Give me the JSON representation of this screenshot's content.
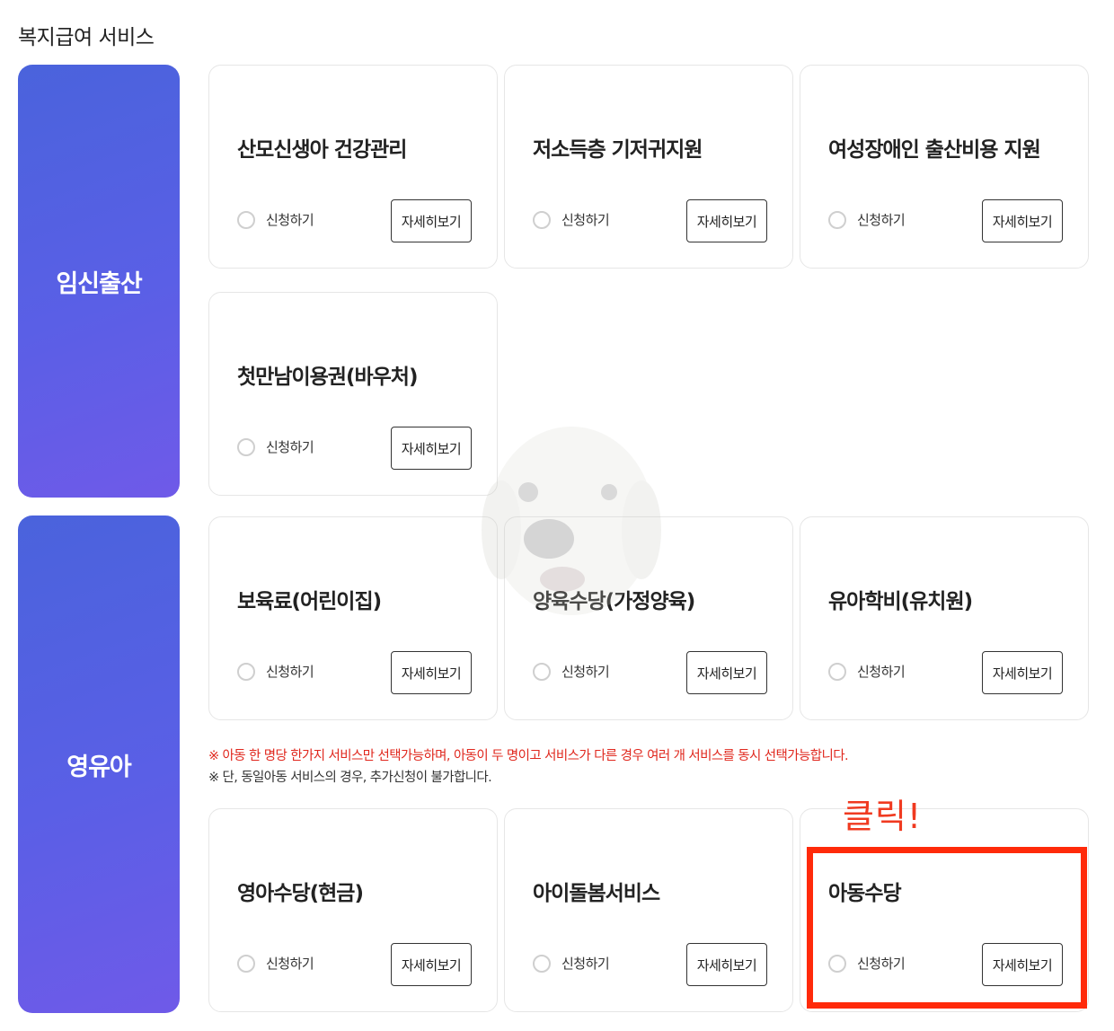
{
  "page_title": "복지급여 서비스",
  "common": {
    "apply_label": "신청하기",
    "detail_label": "자세히보기"
  },
  "categories": [
    {
      "label": "임신출산"
    },
    {
      "label": "영유아"
    }
  ],
  "pregnancy_services": [
    {
      "title": "산모신생아 건강관리"
    },
    {
      "title": "저소득층 기저귀지원"
    },
    {
      "title": "여성장애인 출산비용 지원"
    },
    {
      "title": "첫만남이용권(바우처)"
    }
  ],
  "infant_services_top": [
    {
      "title": "보육료(어린이집)"
    },
    {
      "title": "양육수당(가정양육)"
    },
    {
      "title": "유아학비(유치원)"
    }
  ],
  "notices": [
    "※ 아동 한 명당 한가지 서비스만 선택가능하며, 아동이 두 명이고 서비스가 다른 경우 여러 개 서비스를 동시 선택가능합니다.",
    "※ 단, 동일아동 서비스의 경우, 추가신청이 불가합니다."
  ],
  "infant_services_bottom": [
    {
      "title": "영아수당(현금)"
    },
    {
      "title": "아이돌봄서비스"
    },
    {
      "title": "아동수당"
    }
  ],
  "annotation": {
    "text": "클릭!",
    "color": "#ff2a0a"
  },
  "colors": {
    "category_gradient_start": "#4a63dc",
    "category_gradient_end": "#6f5ae8",
    "notice_red": "#e0281e"
  }
}
